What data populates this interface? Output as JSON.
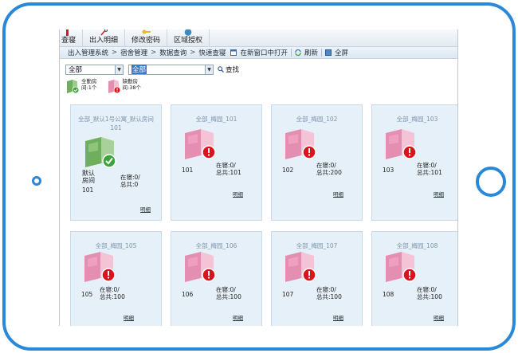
{
  "toolbar": {
    "items": [
      {
        "label": "查寝",
        "icon": "red-pin-icon"
      },
      {
        "label": "出入明细",
        "icon": "wrench-icon"
      },
      {
        "label": "修改密码",
        "icon": "key-icon"
      },
      {
        "label": "区域授权",
        "icon": "globe-icon"
      }
    ]
  },
  "breadcrumb": {
    "items": [
      "出入管理系统",
      "宿舍管理",
      "数据查询",
      "快速查寝"
    ],
    "separator": ">"
  },
  "actions": {
    "open_new_window": "在新窗口中打开",
    "refresh": "刷新",
    "fullscreen": "全屏"
  },
  "filter": {
    "select1_value": "全部",
    "select2_value": "全部",
    "search_label": "查找"
  },
  "legend": [
    {
      "line1": "全勤房",
      "line2": "间:1个",
      "status": "ok"
    },
    {
      "line1": "缺勤房",
      "line2": "间:38个",
      "status": "alert"
    }
  ],
  "rooms": [
    {
      "title": "全部_默认1号公寓_默认房间101",
      "name": "默认房间",
      "number": "101",
      "in_label": "在寝:0/",
      "total_label": "总共:0",
      "status": "ok",
      "detail": "明细"
    },
    {
      "title": "全部_梅园_101",
      "number": "101",
      "in_label": "在寝:0/",
      "total_label": "总共:101",
      "status": "alert",
      "detail": "明细"
    },
    {
      "title": "全部_梅园_102",
      "number": "102",
      "in_label": "在寝:0/",
      "total_label": "总共:200",
      "status": "alert",
      "detail": "明细"
    },
    {
      "title": "全部_梅园_103",
      "number": "103",
      "in_label": "在寝:0/",
      "total_label": "总共:101",
      "status": "alert",
      "detail": "明细"
    },
    {
      "title": "全部_梅园_105",
      "number": "105",
      "in_label": "在寝:0/",
      "total_label": "总共:100",
      "status": "alert",
      "detail": "明细"
    },
    {
      "title": "全部_梅园_106",
      "number": "106",
      "in_label": "在寝:0/",
      "total_label": "总共:100",
      "status": "alert",
      "detail": "明细"
    },
    {
      "title": "全部_梅园_107",
      "number": "107",
      "in_label": "在寝:0/",
      "total_label": "总共:100",
      "status": "alert",
      "detail": "明细"
    },
    {
      "title": "全部_梅园_108",
      "number": "108",
      "in_label": "在寝:0/",
      "total_label": "总共:100",
      "status": "alert",
      "detail": "明细"
    }
  ],
  "colors": {
    "frame": "#2a88d8",
    "card_bg": "#e6f0f9",
    "title_text": "#7b94ae",
    "ok_badge": "#3aa339",
    "alert_badge": "#d8141c",
    "ok_room": "#6fae5d",
    "alert_room": "#e48fb1"
  }
}
